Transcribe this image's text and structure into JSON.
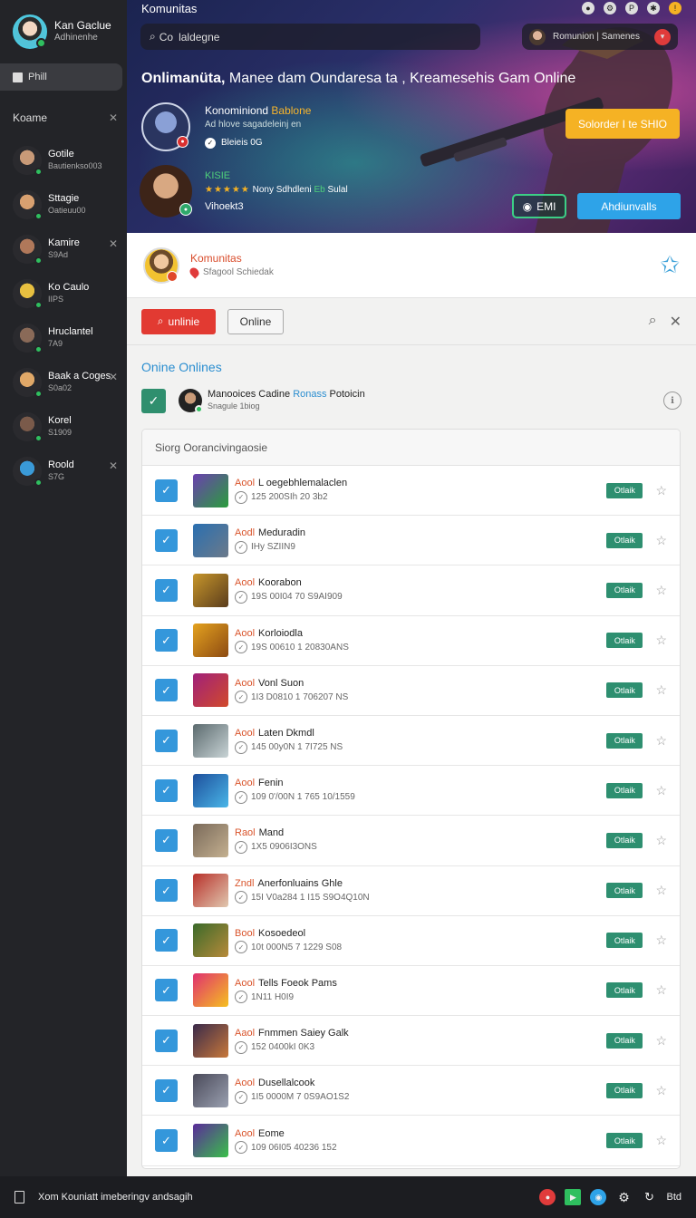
{
  "sidebar": {
    "profile": {
      "name": "Kan Gaclue",
      "subtitle": "Adhinenhe"
    },
    "button_label": "Phill",
    "section_label": "Koame",
    "items": [
      {
        "name": "Gotile",
        "sub": "Bautienkso003",
        "closable": false
      },
      {
        "name": "Sttagie",
        "sub": "Oatieuu00",
        "closable": false
      },
      {
        "name": "Kamire",
        "sub": "S9Ad",
        "closable": true
      },
      {
        "name": "Ko Caulo",
        "sub": "IIPS",
        "closable": false
      },
      {
        "name": "Hruclantel",
        "sub": "7A9",
        "closable": false
      },
      {
        "name": "Baak a Coges",
        "sub": "S0a02",
        "closable": true
      },
      {
        "name": "Korel",
        "sub": "S1909",
        "closable": false
      },
      {
        "name": "Roold",
        "sub": "S7G",
        "closable": true
      }
    ]
  },
  "banner": {
    "title": "Komunitas",
    "search": {
      "prefix": "Co",
      "value": "laldegne"
    },
    "user_label": "Romunion | Samenes",
    "headline_bold": "Onlimanüta,",
    "headline_rest": " Manee dam Oundaresa ta , Kreamesehis Gam Online",
    "feature1": {
      "title": "Konominiond",
      "title_highlight": "Bablone",
      "subtitle": "Ad hlove sagadeleinj en",
      "meta": "Bleieis 0G"
    },
    "cta_yellow": "Solorder I te SHIO",
    "feature2": {
      "tag": "KISIE",
      "stars": "★★★★★",
      "rating_text": "Nony Sdhdleni",
      "rating_green": "Eb",
      "rating_tail": "Sulal",
      "name": "Vihoekt3"
    },
    "btn_emi": "EMI",
    "btn_blue": "Ahdiunvalls"
  },
  "main": {
    "community": {
      "title": "Komunitas",
      "subtitle": "Sfagool Schiedak"
    },
    "toolbar": {
      "primary": "unlinie",
      "secondary": "Online"
    },
    "section_title": "Onine Onlines",
    "moderator": {
      "name": "Manooices Cadine",
      "highlight": "Ronass",
      "tail": "Potoicin",
      "sub": "Snagule 1biog"
    },
    "list_header": "Siorg Oorancivingaosie",
    "badge_label": "Otlaik",
    "rows": [
      {
        "pre": "Aool",
        "name": "L oegebhlemalaclen",
        "meta": "125 200SIh 20 3b2",
        "color1": "#6b3fb0",
        "color2": "#2a9e3c"
      },
      {
        "pre": "Aodl",
        "name": "Meduradin",
        "meta": "IHy SZIIN9",
        "color1": "#2a6fb0",
        "color2": "#6c7a8a"
      },
      {
        "pre": "Aool",
        "name": "Koorabon",
        "meta": "19S 00I04 70 S9AI909",
        "color1": "#c7962b",
        "color2": "#5a3c1c"
      },
      {
        "pre": "Aool",
        "name": "Korloiodla",
        "meta": "19S 00610 1 20830ANS",
        "color1": "#e4a21f",
        "color2": "#8c4a12"
      },
      {
        "pre": "Aool",
        "name": "Vonl Suon",
        "meta": "1I3 D0810 1 706207 NS",
        "color1": "#a0207a",
        "color2": "#d14a2b"
      },
      {
        "pre": "Aool",
        "name": "Laten Dkmdl",
        "meta": "145 00y0N 1 7I725 NS",
        "color1": "#5b6a6e",
        "color2": "#c9d4d6"
      },
      {
        "pre": "Aool",
        "name": "Fenin",
        "meta": "109 0'/00N 1 765 10/1559",
        "color1": "#1e4f9c",
        "color2": "#49b6e8"
      },
      {
        "pre": "Raol",
        "name": "Mand",
        "meta": "1X5 0906I3ONS",
        "color1": "#7a6a5a",
        "color2": "#c4b090"
      },
      {
        "pre": "Zndl",
        "name": "Anerfonluains Ghle",
        "meta": "15I V0a284 1 I15 S9O4Q10N",
        "color1": "#b8302a",
        "color2": "#e0c8b0"
      },
      {
        "pre": "Bool",
        "name": "Kosoedeol",
        "meta": "10t 000N5 7 1229 S08",
        "color1": "#3a6a2a",
        "color2": "#b88a3a"
      },
      {
        "pre": "Aool",
        "name": "Tells Foeok Pams",
        "meta": "1N11 H0I9",
        "color1": "#e03070",
        "color2": "#f5c020"
      },
      {
        "pre": "Aaol",
        "name": "Fnmmen Saiey Galk",
        "meta": "152 0400kI 0K3",
        "color1": "#3a2a4a",
        "color2": "#c8783a"
      },
      {
        "pre": "Aool",
        "name": "Dusellalcook",
        "meta": "1I5 0000M 7 0S9AO1S2",
        "color1": "#4a4a5a",
        "color2": "#9aa0b0"
      },
      {
        "pre": "Aool",
        "name": "Eome",
        "meta": "109 06I05 40236 152",
        "color1": "#5a2a9a",
        "color2": "#3ac04a"
      }
    ]
  },
  "sidebar_avatar_colors": [
    "#c89a78",
    "#d8a070",
    "#b0785a",
    "#e8c040",
    "#8a6a58",
    "#e0a868",
    "#7a5a4a",
    "#3a9ad8"
  ],
  "bottombar": {
    "text": "Xom Kouniatt imeberingv andsagih",
    "right_label": "Btd"
  }
}
